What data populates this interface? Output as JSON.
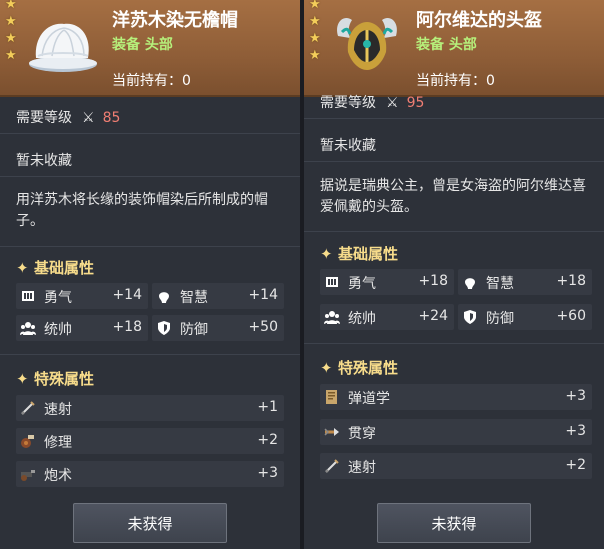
{
  "left": {
    "title": "洋苏木染无檐帽",
    "subtitle": "装备 头部",
    "holding": "当前持有：0",
    "req_label": "需要等级",
    "req_level": "85",
    "collect_status": "暂未收藏",
    "description": "用洋苏木将长缘的装饰帽染后所制成的帽子。",
    "basic_title": "基础属性",
    "basic_stats": [
      {
        "name": "勇气",
        "value": "+14",
        "icon": "courage-icon"
      },
      {
        "name": "智慧",
        "value": "+14",
        "icon": "wisdom-icon"
      },
      {
        "name": "统帅",
        "value": "+18",
        "icon": "command-icon"
      },
      {
        "name": "防御",
        "value": "+50",
        "icon": "defense-icon"
      }
    ],
    "special_title": "特殊属性",
    "special_stats": [
      {
        "name": "速射",
        "value": "+1",
        "icon": "rapid-fire-icon"
      },
      {
        "name": "修理",
        "value": "+2",
        "icon": "repair-icon"
      },
      {
        "name": "炮术",
        "value": "+3",
        "icon": "gunnery-icon"
      }
    ],
    "button": "未获得"
  },
  "right": {
    "title": "阿尔维达的头盔",
    "subtitle": "装备 头部",
    "holding": "当前持有：0",
    "req_label": "需要等级",
    "req_level": "95",
    "collect_status": "暂未收藏",
    "description": "据说是瑞典公主，曾是女海盗的阿尔维达喜爱佩戴的头盔。",
    "basic_title": "基础属性",
    "basic_stats": [
      {
        "name": "勇气",
        "value": "+18",
        "icon": "courage-icon"
      },
      {
        "name": "智慧",
        "value": "+18",
        "icon": "wisdom-icon"
      },
      {
        "name": "统帅",
        "value": "+24",
        "icon": "command-icon"
      },
      {
        "name": "防御",
        "value": "+60",
        "icon": "defense-icon"
      }
    ],
    "special_title": "特殊属性",
    "special_stats": [
      {
        "name": "弹道学",
        "value": "+3",
        "icon": "ballistics-icon"
      },
      {
        "name": "贯穿",
        "value": "+3",
        "icon": "pierce-icon"
      },
      {
        "name": "速射",
        "value": "+2",
        "icon": "rapid-fire-icon"
      }
    ],
    "button": "未获得"
  },
  "colors": {
    "header": "#9a6a41",
    "panel": "#2d3139",
    "subtitle_green": "#b6f07b",
    "level_red": "#f07e73",
    "section_gold": "#f7dc8b"
  }
}
